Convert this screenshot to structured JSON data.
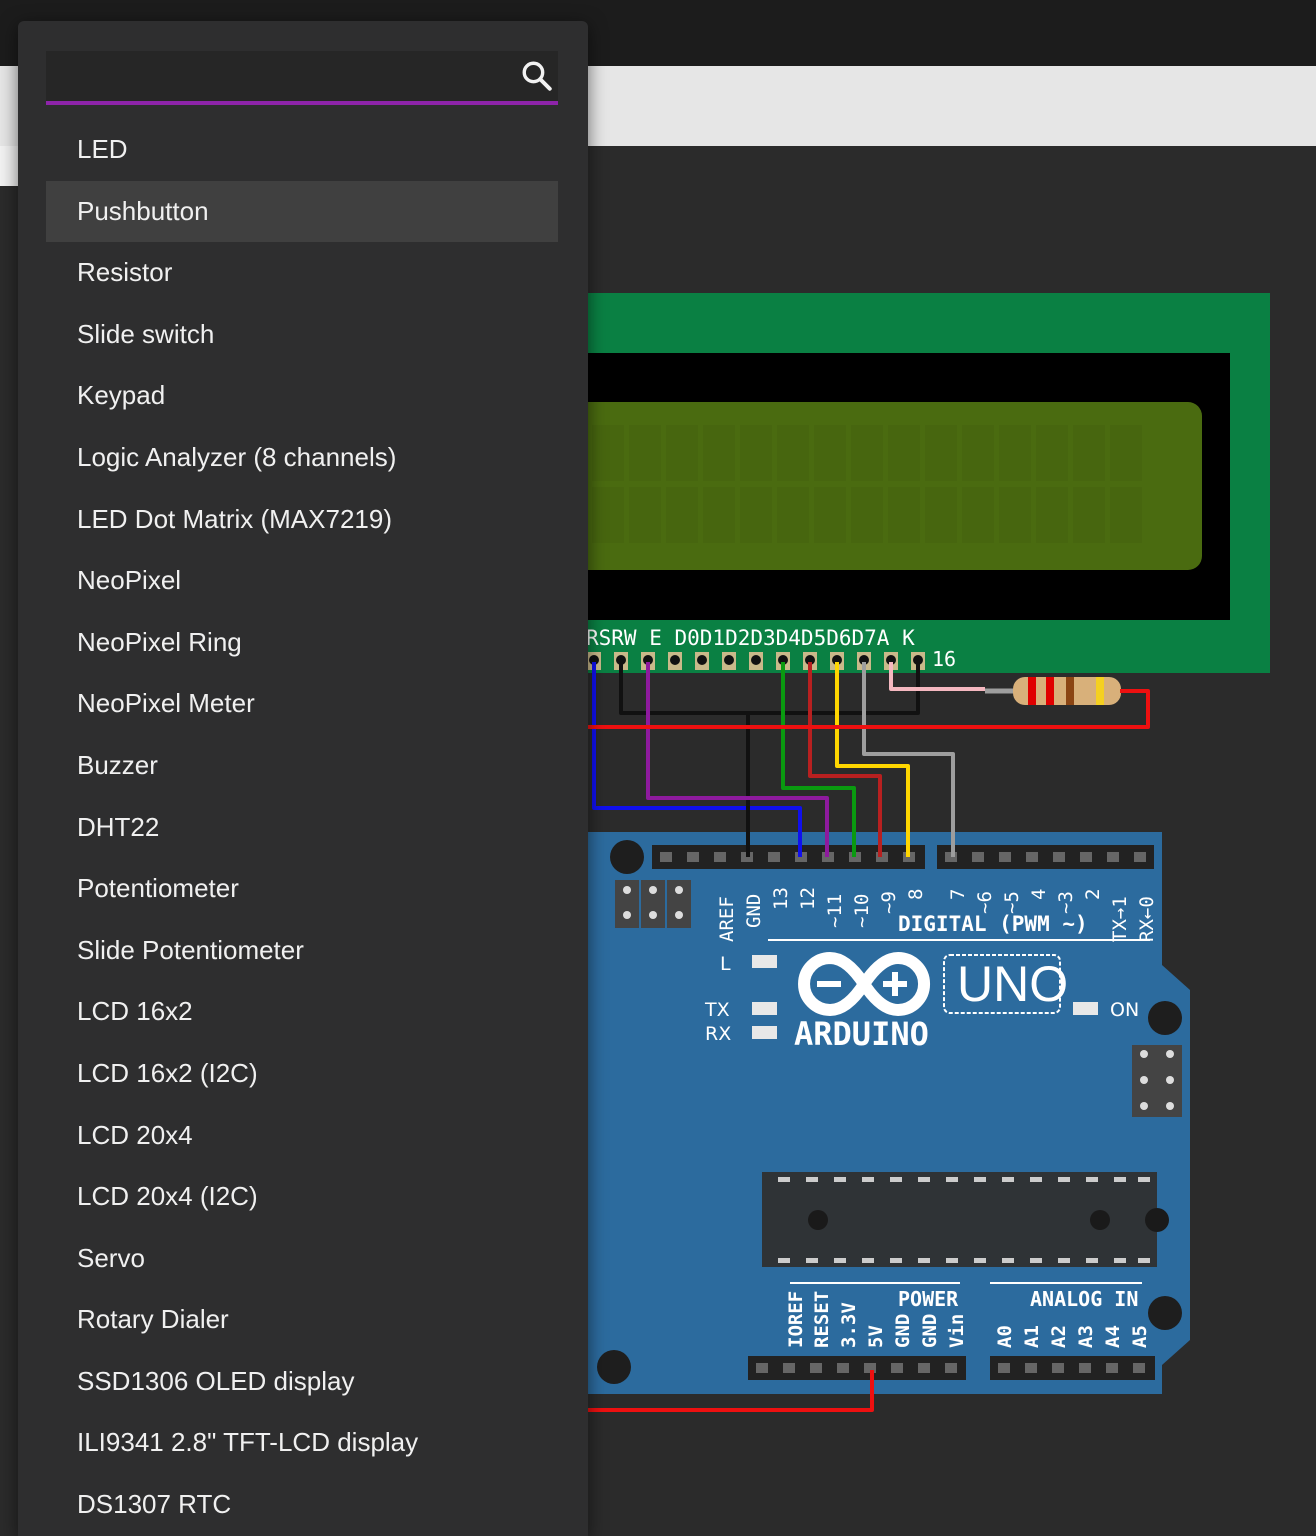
{
  "search": {
    "placeholder": "",
    "value": ""
  },
  "menu_items": [
    "LED",
    "Pushbutton",
    "Resistor",
    "Slide switch",
    "Keypad",
    "Logic Analyzer (8 channels)",
    "LED Dot Matrix (MAX7219)",
    "NeoPixel",
    "NeoPixel Ring",
    "NeoPixel Meter",
    "Buzzer",
    "DHT22",
    "Potentiometer",
    "Slide Potentiometer",
    "LCD 16x2",
    "LCD 16x2 (I2C)",
    "LCD 20x4",
    "LCD 20x4 (I2C)",
    "Servo",
    "Rotary Dialer",
    "SSD1306 OLED display",
    "ILI9341 2.8\" TFT-LCD display",
    "DS1307 RTC"
  ],
  "highlighted_item": "Pushbutton",
  "lcd": {
    "pin_labels": "RSRW E D0D1D2D3D4D5D6D7A  K",
    "pin_count_label": "16"
  },
  "arduino": {
    "brand": "ARDUINO",
    "model": "UNO",
    "digital_label": "DIGITAL (PWM ~)",
    "digital_pins": [
      "AREF",
      "GND",
      "13",
      "12",
      "~11",
      "~10",
      "~9",
      "8",
      "7",
      "~6",
      "~5",
      "4",
      "~3",
      "2",
      "TX→1",
      "RX←0"
    ],
    "led_labels": {
      "l": "L",
      "tx": "TX",
      "rx": "RX",
      "on": "ON"
    },
    "power_label": "POWER",
    "power_pins": [
      "IOREF",
      "RESET",
      "3.3V",
      "5V",
      "GND",
      "GND",
      "Vin"
    ],
    "analog_label": "ANALOG IN",
    "analog_pins": [
      "A0",
      "A1",
      "A2",
      "A3",
      "A4",
      "A5"
    ]
  },
  "colors": {
    "accent": "#8e24aa",
    "lcd_pcb": "#0a8043",
    "lcd_screen": "#4a6b10",
    "arduino_board": "#2c6b9e",
    "menu_bg": "#2e2e2f",
    "menu_hover": "#404040"
  }
}
